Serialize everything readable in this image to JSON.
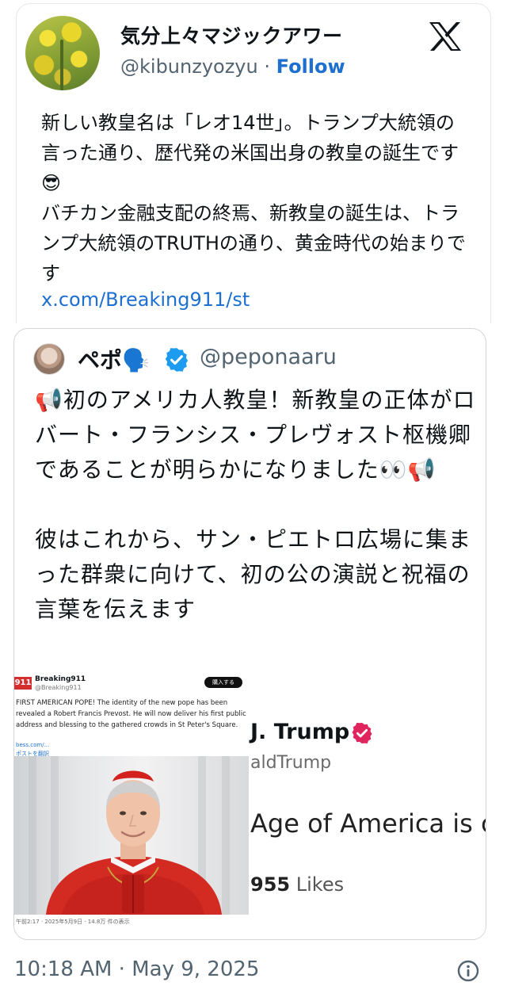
{
  "tweet": {
    "display_name": "気分上々マジックアワー",
    "handle": "@kibunzyozyu",
    "separator": "·",
    "follow_label": "Follow",
    "text": "新しい教皇名は「レオ14世」。トランプ大統領の言った通り、歴代発の米国出身の教皇の誕生です😎\nバチカン金融支配の終焉、新教皇の誕生は、トランプ大統領のTRUTHの通り、黄金時代の始まりです",
    "link": "x.com/Breaking911/st",
    "timestamp": "10:18 AM · May 9, 2025"
  },
  "quoted": {
    "display_name": "ペポ🗣️",
    "handle": "@peponaaru",
    "text": "📢初のアメリカ人教皇！新教皇の正体がロバート・フランシス・プレヴォスト枢機卿であることが明らかになりました👀📢\n\n彼はこれから、サン・ピエトロ広場に集まった群衆に向けて、初の公の演説と祝福の言葉を伝えます",
    "media": {
      "left": {
        "logo": "911",
        "name": "Breaking911",
        "handle": "@Breaking911",
        "button": "購入する",
        "text": "FIRST AMERICAN POPE! The identity of the new pope has been revealed a Robert Francis Prevost. He will now deliver his first public address and blessing to the gathered crowds in St Peter's Square.",
        "link": "bess.com/...",
        "translate": "ポストを翻訳",
        "time": "午前2:17 · 2025年5月9日 · 14.8万 件の表示"
      },
      "right": {
        "name": "J. Trump",
        "handle": "aldTrump",
        "text": "Age of America is c",
        "likes_num": "955",
        "likes_label": "Likes"
      }
    }
  },
  "icons": {
    "x_logo": "x-logo-icon",
    "verified": "verified-badge-icon",
    "info": "info-icon"
  },
  "colors": {
    "link_blue": "#1d6fd0",
    "verified_blue": "#1d9bf0",
    "trump_badge": "#e0245e"
  }
}
